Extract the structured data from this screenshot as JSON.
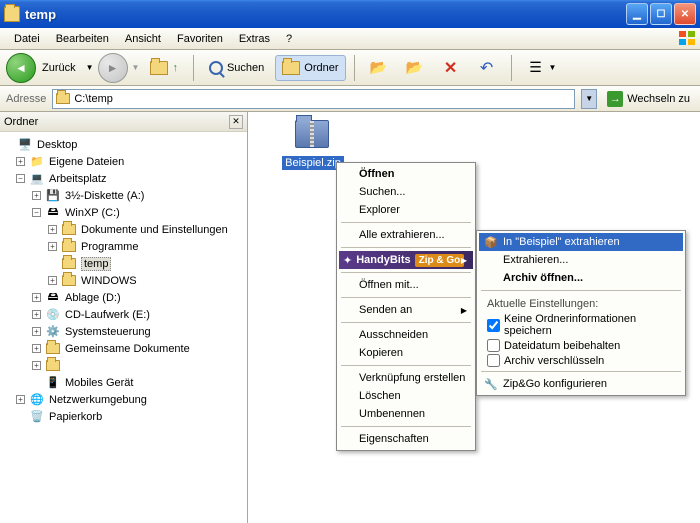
{
  "window": {
    "title": "temp"
  },
  "menubar": {
    "datei": "Datei",
    "bearbeiten": "Bearbeiten",
    "ansicht": "Ansicht",
    "favoriten": "Favoriten",
    "extras": "Extras",
    "hilfe": "?"
  },
  "toolbar": {
    "back": "Zurück",
    "search": "Suchen",
    "folders": "Ordner"
  },
  "address": {
    "label": "Adresse",
    "value": "C:\\temp",
    "go": "Wechseln zu"
  },
  "sidebar": {
    "title": "Ordner",
    "nodes": {
      "desktop": "Desktop",
      "eigene": "Eigene Dateien",
      "arbeitsplatz": "Arbeitsplatz",
      "diskette": "3½-Diskette (A:)",
      "winxp": "WinXP (C:)",
      "dokue": "Dokumente und Einstellungen",
      "programme": "Programme",
      "temp": "temp",
      "windows": "WINDOWS",
      "ablage": "Ablage (D:)",
      "cdlauf": "CD-Laufwerk (E:)",
      "systemst": "Systemsteuerung",
      "gemdok": "Gemeinsame Dokumente",
      "blurred": " ",
      "mobiles": "Mobiles Gerät",
      "netzwerk": "Netzwerkumgebung",
      "papierkorb": "Papierkorb"
    }
  },
  "file": {
    "name": "Beispiel.zip"
  },
  "contextmenu": {
    "oeffnen": "Öffnen",
    "suchen": "Suchen...",
    "explorer": "Explorer",
    "alleextrahieren": "Alle extrahieren...",
    "handybits": "HandyBits",
    "zipgo": "Zip & Go",
    "oeffnenmit": "Öffnen mit...",
    "sendenan": "Senden an",
    "ausschneiden": "Ausschneiden",
    "kopieren": "Kopieren",
    "verknuepfung": "Verknüpfung erstellen",
    "loeschen": "Löschen",
    "umbenennen": "Umbenennen",
    "eigenschaften": "Eigenschaften"
  },
  "submenu": {
    "inextrahieren": "In \"Beispiel\" extrahieren",
    "extrahieren": "Extrahieren...",
    "archivoeffnen": "Archiv öffnen...",
    "aktuelle": "Aktuelle Einstellungen:",
    "keineordner": "Keine Ordnerinformationen speichern",
    "dateidatum": "Dateidatum beibehalten",
    "archivversch": "Archiv verschlüsseln",
    "konfigurieren": "Zip&Go konfigurieren"
  }
}
